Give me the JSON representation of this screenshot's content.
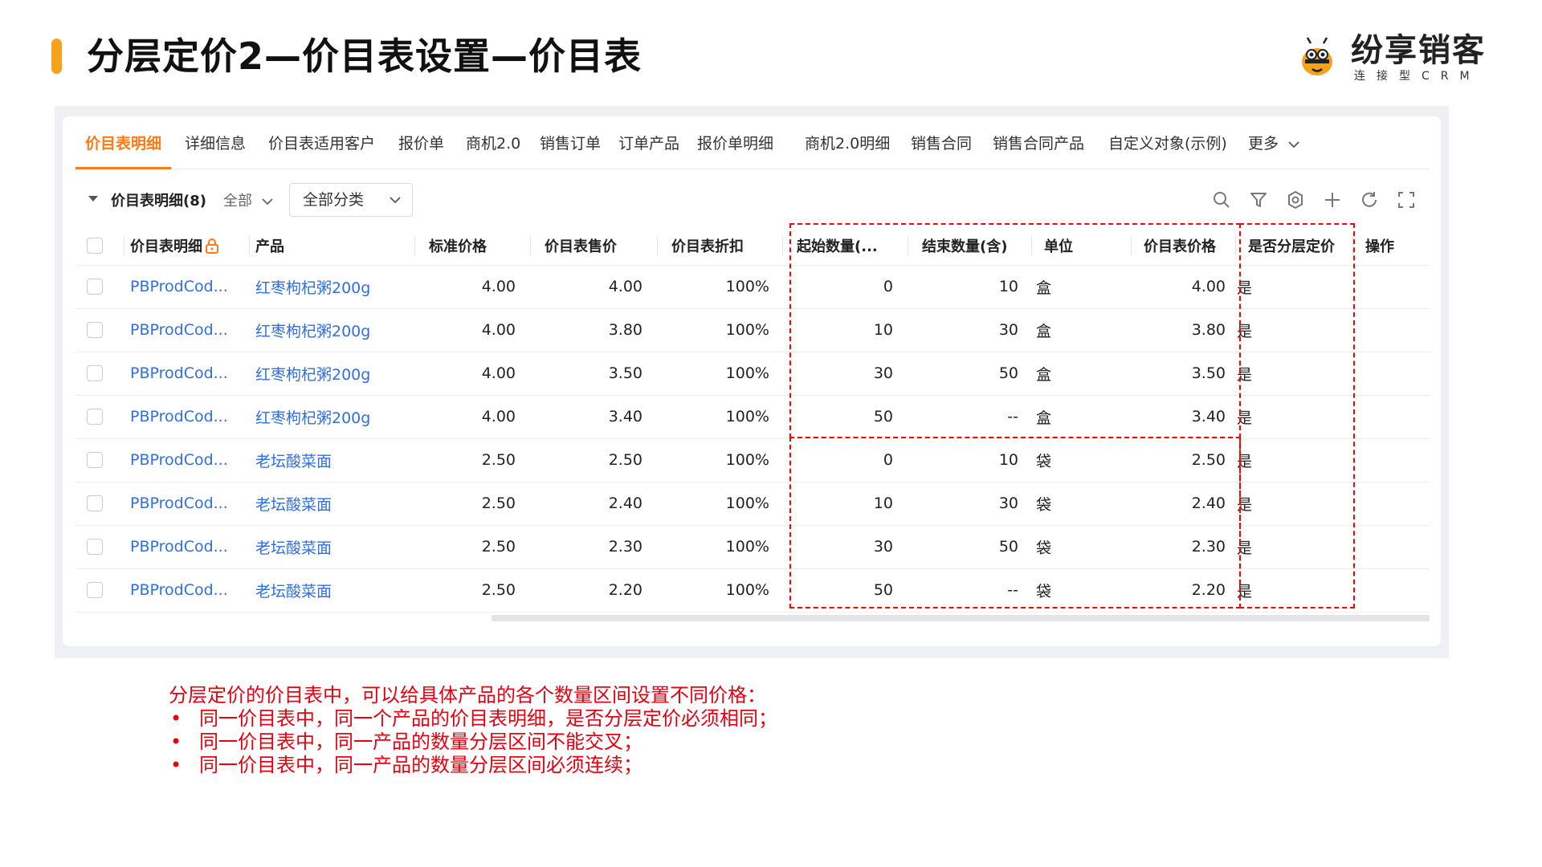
{
  "slide": {
    "title": "分层定价2—价目表设置—价目表",
    "accent_color": "#f7a21b"
  },
  "logo": {
    "name": "纷享销客",
    "tagline": "连接型CRM",
    "icon": "bee-mascot-icon"
  },
  "colors": {
    "active_tab": "#ff7a14",
    "link": "#2f6fe0",
    "annotation": "#ff0000",
    "note_text": "#e8000f"
  },
  "tabs": [
    {
      "label": "价目表明细",
      "active": true
    },
    {
      "label": "详细信息"
    },
    {
      "label": "价目表适用客户"
    },
    {
      "label": "报价单"
    },
    {
      "label": "商机2.0"
    },
    {
      "label": "销售订单"
    },
    {
      "label": "订单产品"
    },
    {
      "label": "报价单明细"
    },
    {
      "label": "商机2.0明细"
    },
    {
      "label": "销售合同"
    },
    {
      "label": "销售合同产品"
    },
    {
      "label": "自定义对象(示例)"
    },
    {
      "label": "更多"
    }
  ],
  "toolbar": {
    "list_title": "价目表明细(8)",
    "scope": "全部",
    "category_select": "全部分类",
    "icons": [
      "search-icon",
      "filter-icon",
      "settings-icon",
      "add-icon",
      "refresh-icon",
      "fullscreen-icon"
    ]
  },
  "table": {
    "columns": [
      "价目表明细",
      "产品",
      "标准价格",
      "价目表售价",
      "价目表折扣",
      "起始数量(...",
      "结束数量(含)",
      "单位",
      "价目表价格",
      "是否分层定价",
      "操作"
    ],
    "rows": [
      [
        "PBProdCod...",
        "红枣枸杞粥200g",
        "4.00",
        "4.00",
        "100%",
        "0",
        "10",
        "盒",
        "4.00",
        "是"
      ],
      [
        "PBProdCod...",
        "红枣枸杞粥200g",
        "4.00",
        "3.80",
        "100%",
        "10",
        "30",
        "盒",
        "3.80",
        "是"
      ],
      [
        "PBProdCod...",
        "红枣枸杞粥200g",
        "4.00",
        "3.50",
        "100%",
        "30",
        "50",
        "盒",
        "3.50",
        "是"
      ],
      [
        "PBProdCod...",
        "红枣枸杞粥200g",
        "4.00",
        "3.40",
        "100%",
        "50",
        "--",
        "盒",
        "3.40",
        "是"
      ],
      [
        "PBProdCod...",
        "老坛酸菜面",
        "2.50",
        "2.50",
        "100%",
        "0",
        "10",
        "袋",
        "2.50",
        "是"
      ],
      [
        "PBProdCod...",
        "老坛酸菜面",
        "2.50",
        "2.40",
        "100%",
        "10",
        "30",
        "袋",
        "2.40",
        "是"
      ],
      [
        "PBProdCod...",
        "老坛酸菜面",
        "2.50",
        "2.30",
        "100%",
        "30",
        "50",
        "袋",
        "2.30",
        "是"
      ],
      [
        "PBProdCod...",
        "老坛酸菜面",
        "2.50",
        "2.20",
        "100%",
        "50",
        "--",
        "袋",
        "2.20",
        "是"
      ]
    ]
  },
  "notes": {
    "intro": "分层定价的价目表中，可以给具体产品的各个数量区间设置不同价格：",
    "bullet_symbol": "•",
    "bullets": [
      "同一价目表中，同一个产品的价目表明细，是否分层定价必须相同；",
      "同一价目表中，同一产品的数量分层区间不能交叉；",
      "同一价目表中，同一产品的数量分层区间必须连续；"
    ]
  }
}
